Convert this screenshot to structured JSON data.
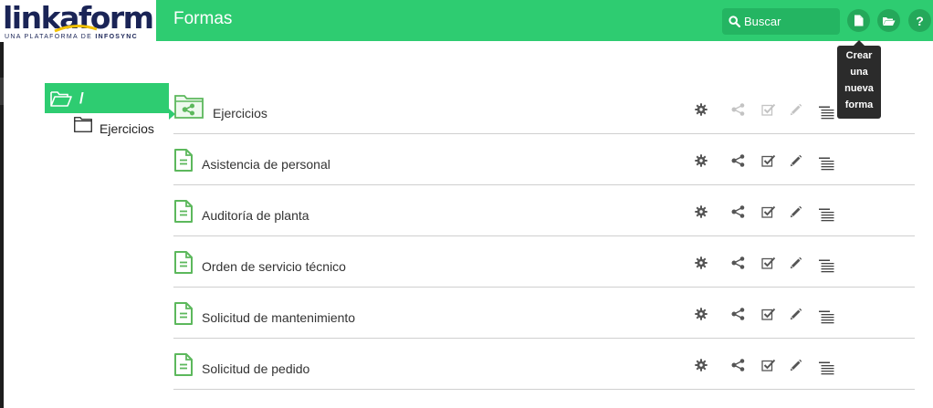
{
  "brand": {
    "word": "linkaform",
    "tagline_prefix": "UNA PLATAFORMA DE ",
    "tagline_brand": "INFOSYNC"
  },
  "header": {
    "title": "Formas",
    "search_label": "Buscar",
    "help_label": "?"
  },
  "tooltip": {
    "lines": [
      "Crear",
      "una",
      "nueva",
      "forma"
    ]
  },
  "tree": {
    "root_label": "/",
    "children": [
      {
        "label": "Ejercicios"
      }
    ]
  },
  "items": [
    {
      "label": "Ejercicios",
      "kind": "folder"
    },
    {
      "label": "Asistencia de personal",
      "kind": "form"
    },
    {
      "label": "Auditoría de planta",
      "kind": "form"
    },
    {
      "label": "Orden de servicio técnico",
      "kind": "form"
    },
    {
      "label": "Solicitud de mantenimiento",
      "kind": "form"
    },
    {
      "label": "Solicitud de pedido",
      "kind": "form"
    }
  ],
  "actions": [
    "gear-icon",
    "share-icon",
    "checkbox-icon",
    "pencil-icon",
    "records-list-icon"
  ],
  "colors": {
    "primary": "#2ecc71",
    "primary_dark": "#24b562",
    "brand_navy": "#1a2456",
    "brand_yellow": "#f2c200",
    "icon_gray": "#555555"
  }
}
